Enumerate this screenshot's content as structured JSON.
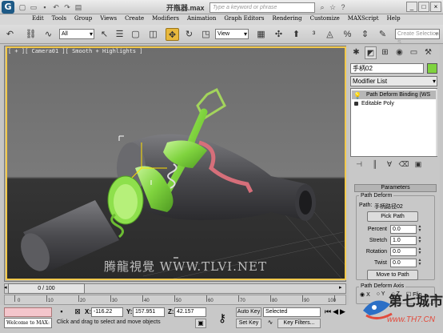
{
  "title_bar": {
    "doc_title": "开瓶器.max",
    "search_placeholder": "Type a keyword or phrase"
  },
  "menu": [
    "Edit",
    "Tools",
    "Group",
    "Views",
    "Create",
    "Modifiers",
    "Animation",
    "Graph Editors",
    "Rendering",
    "Customize",
    "MAXScript",
    "Help"
  ],
  "toolbar": {
    "filter_value": "All",
    "coord_value": "View",
    "selection_set_placeholder": "Create Selection S"
  },
  "viewport": {
    "label": "[ + ][ Camera01 ][ Smooth + Highlights ]",
    "watermark": "腾龍視覺 WWW.TLVI.NET"
  },
  "command_panel": {
    "object_name": "手柄02",
    "modifier_list": "Modifier List",
    "stack": [
      "Path Deform Binding (WS",
      "Editable Poly"
    ],
    "rollout_title": "Parameters",
    "path_deform_group": "Path Deform",
    "path_label": "Path:",
    "path_value": "手柄路径02",
    "pick_path": "Pick Path",
    "params": [
      {
        "label": "Percent",
        "value": "0.0"
      },
      {
        "label": "Stretch",
        "value": "1.0"
      },
      {
        "label": "Rotation",
        "value": "0.0"
      },
      {
        "label": "Twist",
        "value": "0.0"
      }
    ],
    "move_to_path": "Move to Path",
    "axis_group": "Path Deform Axis",
    "axes": [
      "X",
      "Y",
      "Z"
    ],
    "flip": "Flip"
  },
  "time_slider": {
    "value": "0 / 100",
    "ticks": [
      "0",
      "10",
      "20",
      "30",
      "40",
      "50",
      "60",
      "70",
      "80",
      "90",
      "100"
    ]
  },
  "status": {
    "welcome": "Welcome to MAX:",
    "message": "Click and drag to select and move objects",
    "x_label": "X:",
    "x_value": "-116.22",
    "y_label": "Y:",
    "y_value": "157.951",
    "z_label": "Z:",
    "z_value": "42.157",
    "auto_key": "Auto Key",
    "selected": "Selected",
    "set_key": "Set Key",
    "key_filters": "Key Filters..."
  },
  "site_watermark": {
    "line1": "第七城市",
    "line2": "www.TH7.CN"
  }
}
